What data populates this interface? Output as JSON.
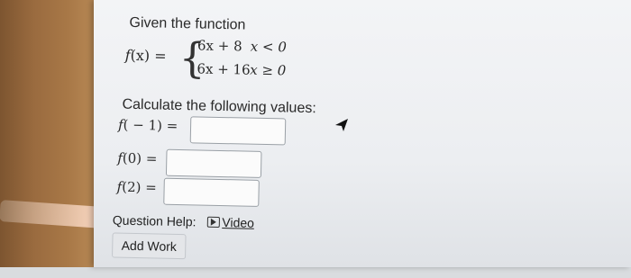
{
  "intro": "Given the function",
  "function_lhs_f": "f",
  "function_lhs_var": "(x) =",
  "cases": [
    {
      "expr": "6x + 8",
      "cond": "x < 0"
    },
    {
      "expr": "6x + 16",
      "cond": "x ≥ 0"
    }
  ],
  "calculate_label": "Calculate the following values:",
  "rows": [
    {
      "f": "f",
      "arg": "( − 1) =",
      "value": ""
    },
    {
      "f": "f",
      "arg": "(0) =",
      "value": ""
    },
    {
      "f": "f",
      "arg": "(2) =",
      "value": ""
    }
  ],
  "help_label": "Question Help:",
  "video_label": "Video",
  "add_work_label": "Add Work"
}
